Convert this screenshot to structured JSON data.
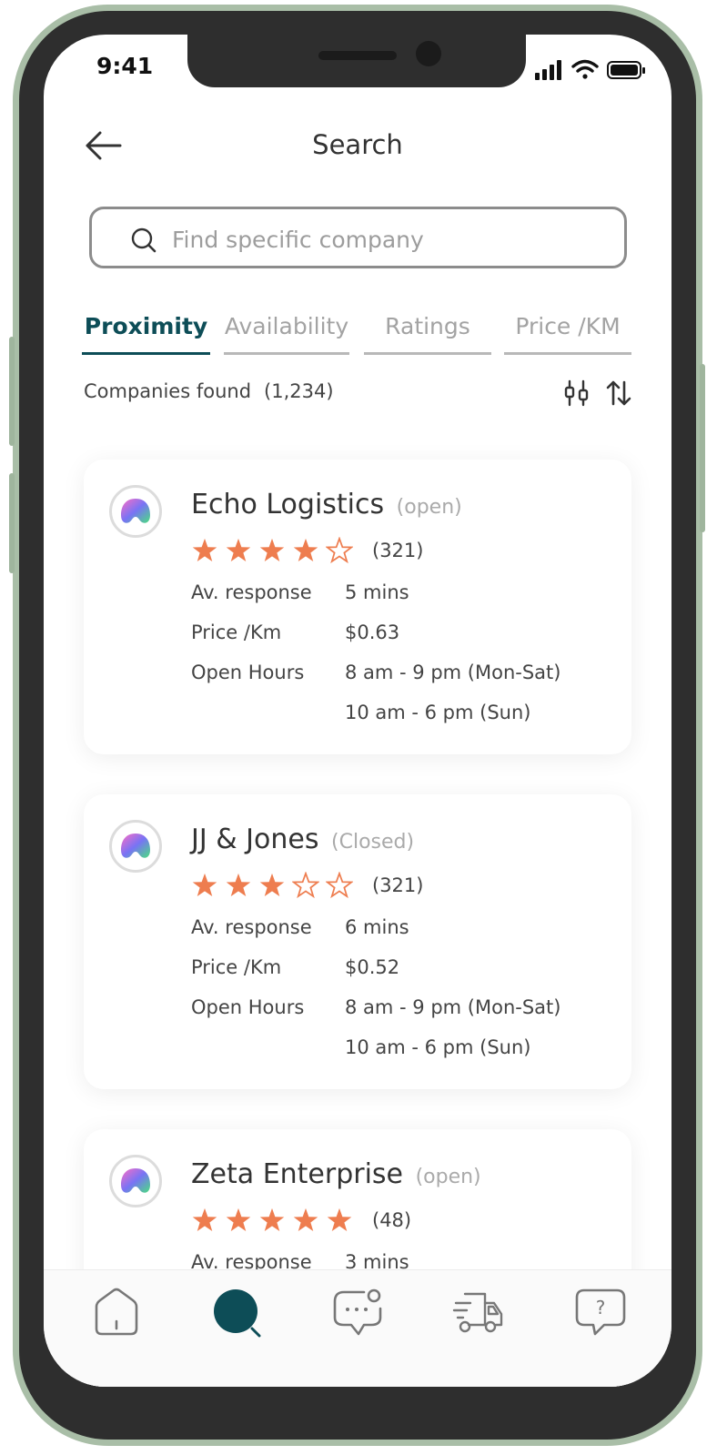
{
  "status_bar": {
    "time": "9:41"
  },
  "header": {
    "title": "Search"
  },
  "search": {
    "placeholder": "Find specific company"
  },
  "tabs": [
    {
      "label": "Proximity",
      "active": true
    },
    {
      "label": "Availability",
      "active": false
    },
    {
      "label": "Ratings",
      "active": false
    },
    {
      "label": "Price /KM",
      "active": false
    }
  ],
  "results": {
    "label": "Companies found",
    "count": "(1,234)"
  },
  "labels": {
    "response": "Av. response",
    "price": "Price /Km",
    "hours": "Open Hours"
  },
  "companies": [
    {
      "name": "Echo Logistics",
      "status": "(open)",
      "rating": 4,
      "reviews": "(321)",
      "response": "5 mins",
      "price": "$0.63",
      "hours_1": "8 am - 9 pm (Mon-Sat)",
      "hours_2": "10 am - 6 pm (Sun)"
    },
    {
      "name": "JJ & Jones",
      "status": "(Closed)",
      "rating": 3,
      "reviews": "(321)",
      "response": "6 mins",
      "price": "$0.52",
      "hours_1": "8 am - 9 pm (Mon-Sat)",
      "hours_2": "10 am - 6 pm (Sun)"
    },
    {
      "name": "Zeta Enterprise",
      "status": "(open)",
      "rating": 5,
      "reviews": "(48)",
      "response": "3 mins"
    }
  ],
  "bottom_nav": [
    {
      "icon": "home-icon",
      "active": false
    },
    {
      "icon": "search-icon",
      "active": true
    },
    {
      "icon": "chat-icon",
      "active": false
    },
    {
      "icon": "delivery-truck-icon",
      "active": false
    },
    {
      "icon": "help-icon",
      "active": false
    }
  ],
  "colors": {
    "accent": "#0d4d57",
    "star": "#ee7d4f",
    "inactive": "#a3a3a3",
    "frame": "#a9bea7"
  }
}
